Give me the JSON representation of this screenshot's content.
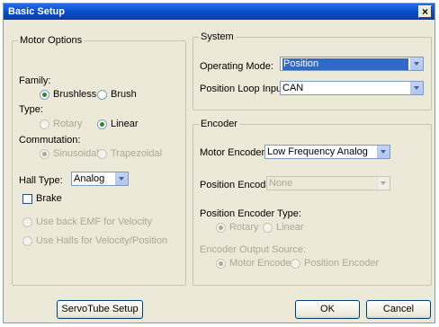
{
  "window": {
    "title": "Basic Setup",
    "close_glyph": "×"
  },
  "motor_options": {
    "legend": "Motor Options",
    "family_label": "Family:",
    "family": [
      "Brushless",
      "Brush"
    ],
    "type_label": "Type:",
    "type": [
      "Rotary",
      "Linear"
    ],
    "commutation_label": "Commutation:",
    "commutation": [
      "Sinusoidal",
      "Trapezoidal"
    ],
    "hall_type_label": "Hall Type:",
    "hall_type_value": "Analog",
    "brake_label": "Brake",
    "back_emf_label": "Use back EMF for Velocity",
    "halls_label": "Use Halls for Velocity/Position"
  },
  "system": {
    "legend": "System",
    "operating_mode_label": "Operating Mode:",
    "operating_mode_value": "Position",
    "position_loop_label": "Position Loop Input:",
    "position_loop_value": "CAN"
  },
  "encoder": {
    "legend": "Encoder",
    "motor_encoder_label": "Motor Encoder:",
    "motor_encoder_value": "Low Frequency Analog",
    "position_encoder_label": "Position Encoder:",
    "position_encoder_value": "None",
    "position_encoder_type_label": "Position Encoder Type:",
    "position_encoder_type": [
      "Rotary",
      "Linear"
    ],
    "output_source_label": "Encoder Output Source:",
    "output_source": [
      "Motor Encoder",
      "Position Encoder"
    ]
  },
  "buttons": {
    "servotube": "ServoTube Setup",
    "ok": "OK",
    "cancel": "Cancel"
  }
}
